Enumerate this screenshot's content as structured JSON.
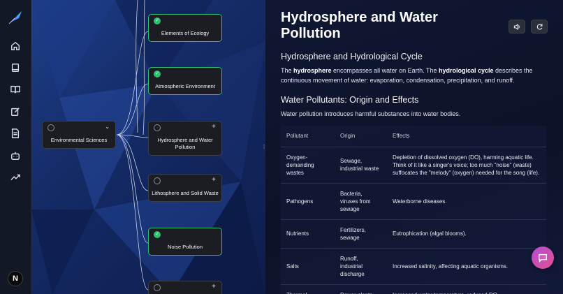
{
  "sidebar": {
    "logo": "quill-pen-logo",
    "items": [
      {
        "icon": "home-icon"
      },
      {
        "icon": "book-icon"
      },
      {
        "icon": "open-book-icon"
      },
      {
        "icon": "edit-note-icon"
      },
      {
        "icon": "document-icon"
      },
      {
        "icon": "robot-icon"
      },
      {
        "icon": "trending-up-icon"
      }
    ],
    "avatar_letter": "N"
  },
  "mindmap": {
    "root": {
      "label": "Environmental Sciences"
    },
    "children": [
      {
        "label": "Elements of Ecology",
        "status": "done"
      },
      {
        "label": "Atmospheric Environment",
        "status": "done"
      },
      {
        "label": "Hydrosphere and Water Pollution",
        "status": "open"
      },
      {
        "label": "Lithosphere and Solid Waste",
        "status": "open"
      },
      {
        "label": "Noise Pollution",
        "status": "done"
      },
      {
        "label": "",
        "status": "open"
      }
    ]
  },
  "panel": {
    "title": "Hydrosphere and Water Pollution",
    "section1": "Hydrosphere and Hydrological Cycle",
    "para1_a": "The ",
    "para1_b": "hydrosphere",
    "para1_c": " encompasses all water on Earth. The ",
    "para1_d": "hydrological cycle",
    "para1_e": " describes the continuous movement of water: evaporation, condensation, precipitation, and runoff.",
    "section2": "Water Pollutants: Origin and Effects",
    "para2": "Water pollution introduces harmful substances into water bodies.",
    "table": {
      "headers": [
        "Pollutant",
        "Origin",
        "Effects"
      ],
      "rows": [
        [
          "Oxygen-demanding wastes",
          "Sewage, industrial waste",
          "Depletion of dissolved oxygen (DO), harming aquatic life. Think of it like a singer's voice; too much \"noise\" (waste) suffocates the \"melody\" (oxygen) needed for the song (life)."
        ],
        [
          "Pathogens",
          "Bacteria, viruses from sewage",
          "Waterborne diseases."
        ],
        [
          "Nutrients",
          "Fertilizers, sewage",
          "Eutrophication (algal blooms)."
        ],
        [
          "Salts",
          "Runoff, industrial discharge",
          "Increased salinity, affecting aquatic organisms."
        ],
        [
          "Thermal",
          "Power plants",
          "Increased water temperature, reduced DO"
        ]
      ]
    }
  },
  "colors": {
    "accent_green": "#2fbf71",
    "fab_gradient_start": "#b44cd6",
    "fab_gradient_end": "#e0518f"
  }
}
